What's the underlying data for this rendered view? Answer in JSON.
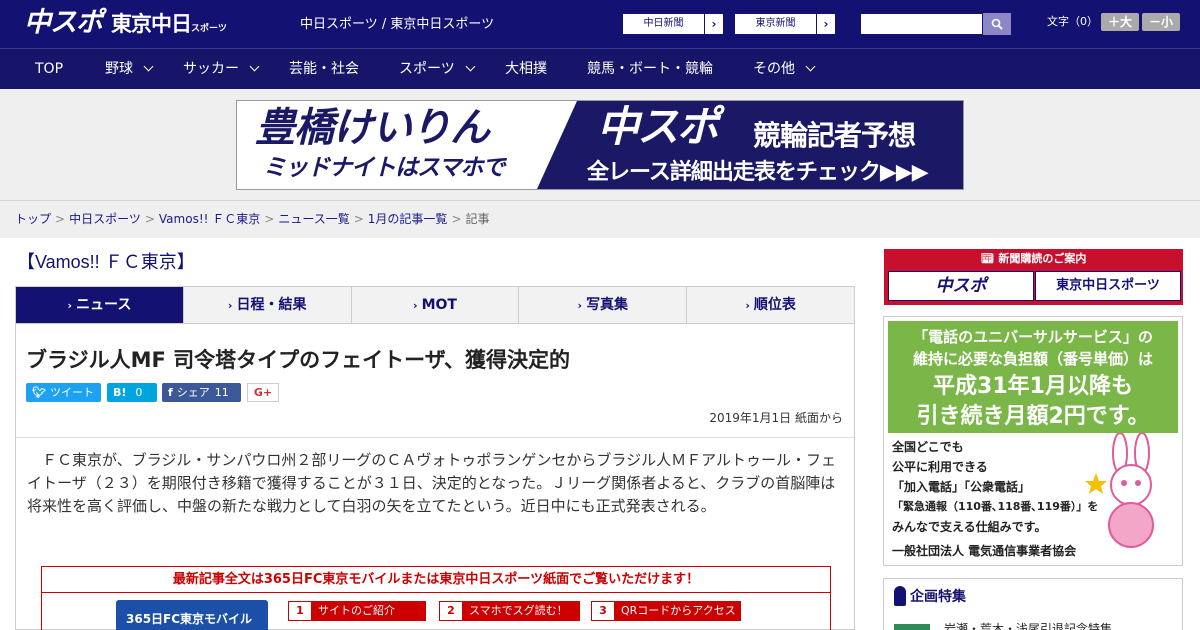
{
  "header": {
    "logo_chuspo": "中スポ",
    "logo_tokyo": "東京中日",
    "logo_tokyo_sub": "スポーツ",
    "site_title": "中日スポーツ / 東京中日スポーツ",
    "paper_links": [
      {
        "label": "中日新聞"
      },
      {
        "label": "東京新聞"
      }
    ],
    "search_placeholder": "",
    "font_label": "文字（0）",
    "font_plus": "＋大",
    "font_minus": "－小"
  },
  "nav": {
    "items": [
      {
        "label": "TOP",
        "dropdown": false
      },
      {
        "label": "野球",
        "dropdown": true
      },
      {
        "label": "サッカー",
        "dropdown": true
      },
      {
        "label": "芸能・社会",
        "dropdown": false
      },
      {
        "label": "スポーツ",
        "dropdown": true
      },
      {
        "label": "大相撲",
        "dropdown": false
      },
      {
        "label": "競馬・ボート・競輪",
        "dropdown": false
      },
      {
        "label": "その他",
        "dropdown": true
      }
    ]
  },
  "banner": {
    "line1": "豊橋けいりん",
    "line2": "ミッドナイトはスマホで",
    "brand": "中スポ",
    "title": "競輪記者予想",
    "cta": "全レース詳細出走表をチェック▶▶▶"
  },
  "breadcrumb": {
    "items": [
      "トップ",
      "中日スポーツ",
      "Vamos!! ＦＣ東京",
      "ニュース一覧",
      "1月の記事一覧"
    ],
    "current": "記事",
    "separator": ">"
  },
  "category_title": "【Vamos!! ＦＣ東京】",
  "tabs": [
    {
      "label": "ニュース",
      "active": true
    },
    {
      "label": "日程・結果",
      "active": false
    },
    {
      "label": "MOT",
      "active": false
    },
    {
      "label": "写真集",
      "active": false
    },
    {
      "label": "順位表",
      "active": false
    }
  ],
  "article": {
    "headline": "ブラジル人MF 司令塔タイプのフェイトーザ、獲得決定的",
    "share": {
      "tweet_label": "ツイート",
      "hatena_label": "B!",
      "hatena_count": "0",
      "facebook_label": "シェア",
      "facebook_count": "11",
      "gplus_label": "G+"
    },
    "date": "2019年1月1日 紙面から",
    "body": "ＦＣ東京が、ブラジル・サンパウロ州２部リーグのＣＡヴォトゥポランゲンセからブラジル人ＭＦアルトゥール・フェイトーザ（２３）を期限付き移籍で獲得することが３１日、決定的となった。Ｊリーグ関係者よると、クラブの首脳陣は将来性を高く評価し、中盤の新たな戦力として白羽の矢を立てたという。近日中にも正式発表される。"
  },
  "promo": {
    "title": "最新記事全文は365日FC東京モバイルまたは東京中日スポーツ紙面でご覧いただけます！",
    "mobile_label": "365日FC東京モバイル",
    "steps": [
      {
        "num": "1",
        "label": "サイトのご紹介"
      },
      {
        "num": "2",
        "label": "スマホでスグ読む！"
      },
      {
        "num": "3",
        "label": "QRコードからアクセス"
      }
    ]
  },
  "sidebar": {
    "subscribe_title": "新聞購読のご案内",
    "subscribe_logos": [
      "中スポ",
      "東京中日スポーツ"
    ],
    "ad": {
      "line1": "「電話のユニバーサルサービス」の",
      "line2": "維持に必要な負担額（番号単価）は",
      "line3": "平成31年1月以降も",
      "line4": "引き続き月額2円です。",
      "text1": "全国どこでも",
      "text2": "公平に利用できる",
      "text3": "「加入電話」「公衆電話」",
      "text4": "「緊急通報（110番､118番､119番）」を",
      "text5": "みんなで支える仕組みです。",
      "org": "一般社団法人 電気通信事業者協会"
    },
    "kikaku_title": "企画特集",
    "kikaku_item": "岩瀬・荒木・浅尾引退記念特集"
  },
  "colors": {
    "header_bg": "#131171",
    "nav_bg": "#171569",
    "accent_red": "#c00",
    "twitter": "#1da1f2",
    "hatena": "#00a4de",
    "facebook": "#3b5998"
  }
}
